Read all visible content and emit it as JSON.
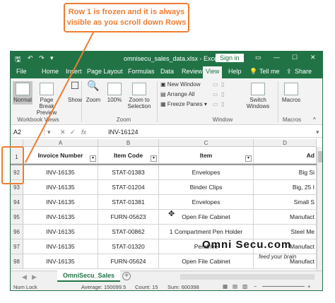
{
  "callout": {
    "line1": "Row 1 is frozen and it is always",
    "line2": "visible as you scroll down Rows"
  },
  "colors": {
    "accent": "#217346",
    "callout": "#ed7d31"
  },
  "window": {
    "title": "omnisecu_sales_data.xlsx  -  Excel",
    "signin": "Sign in"
  },
  "tabs": [
    "File",
    "Home",
    "Insert",
    "Page Layout",
    "Formulas",
    "Data",
    "Review",
    "View",
    "Help"
  ],
  "tell_me": "Tell me",
  "share": "Share",
  "ribbon": {
    "normal": "Normal",
    "page_break": "Page Break Preview",
    "show": "Show",
    "zoom": "Zoom",
    "zoom100": "100%",
    "zoom_sel": "Zoom to Selection",
    "new_window": "New Window",
    "arrange_all": "Arrange All",
    "freeze": "Freeze Panes",
    "switch": "Switch Windows",
    "macros": "Macros",
    "grp_views": "Workbook Views",
    "grp_zoom": "Zoom",
    "grp_window": "Window",
    "grp_macros": "Macros"
  },
  "formula_bar": {
    "name_box": "A2",
    "fx": "fx",
    "value": "INV-16124"
  },
  "columns": [
    "A",
    "B",
    "C",
    "D"
  ],
  "header_row": {
    "num": "1",
    "cells": [
      "Invoice Number",
      "Item Code",
      "Item",
      "Ad"
    ]
  },
  "rows": [
    {
      "num": "92",
      "cells": [
        "INV-16135",
        "STAT-01383",
        "Envelopes",
        "Big Si"
      ]
    },
    {
      "num": "93",
      "cells": [
        "INV-16135",
        "STAT-01204",
        "Binder Clips",
        "Big, 25 I"
      ]
    },
    {
      "num": "94",
      "cells": [
        "INV-16135",
        "STAT-01381",
        "Envelopes",
        "Small S"
      ]
    },
    {
      "num": "95",
      "cells": [
        "INV-16135",
        "FURN-05623",
        "Open File Cabinet",
        "Manufact"
      ]
    },
    {
      "num": "96",
      "cells": [
        "INV-16135",
        "STAT-00862",
        "1 Compartment Pen Holder",
        "Steel Me"
      ]
    },
    {
      "num": "97",
      "cells": [
        "INV-16135",
        "STAT-01320",
        "Pendrive",
        "Manufact"
      ]
    },
    {
      "num": "98",
      "cells": [
        "INV-16135",
        "FURN-05624",
        "Open File Cabinet",
        "Manufact"
      ]
    }
  ],
  "sheet": {
    "name": "OmniSecu_Sales"
  },
  "status": {
    "mode": "Num Lock",
    "average": "Average: 150099.5",
    "count": "Count: 15",
    "sum": "Sum: 600398"
  },
  "watermark": {
    "brand": "Omni Secu.com",
    "tagline": "feed your brain"
  }
}
